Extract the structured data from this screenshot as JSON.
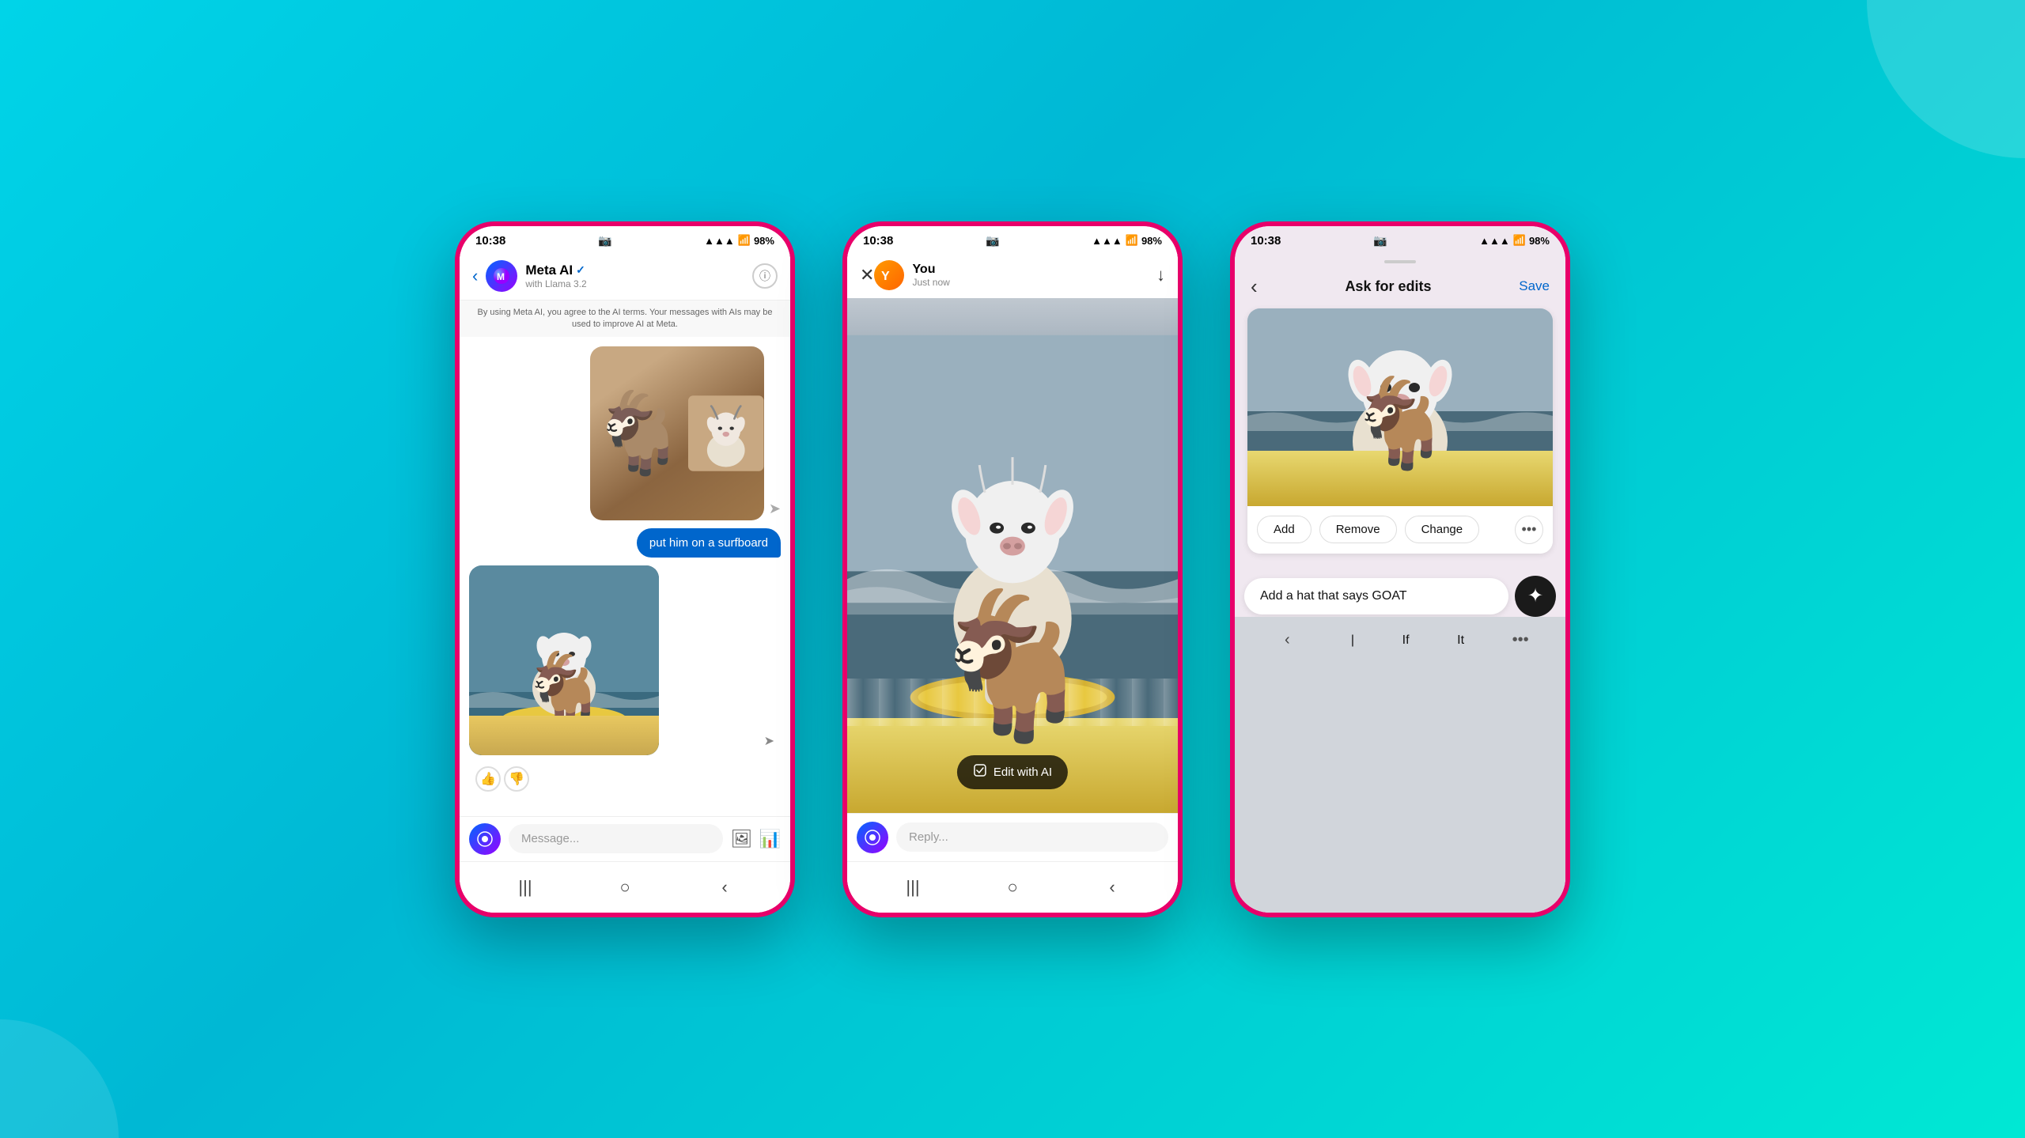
{
  "background": {
    "color": "#00d4e8"
  },
  "phone1": {
    "statusBar": {
      "time": "10:38",
      "battery": "98%"
    },
    "header": {
      "title": "Meta AI",
      "verified": true,
      "subtitle": "with Llama 3.2"
    },
    "disclaimer": "By using Meta AI, you agree to the AI terms. Your messages with AIs may be used to improve AI at Meta.",
    "message": {
      "bubble": "put him on a surfboard"
    },
    "reactions": {
      "thumbsUp": "👍",
      "thumbsDown": "👎"
    },
    "input": {
      "placeholder": "Message..."
    },
    "nav": {
      "menu": "☰",
      "home": "○",
      "back": "‹"
    }
  },
  "phone2": {
    "statusBar": {
      "time": "10:38",
      "battery": "98%"
    },
    "header": {
      "user": "You",
      "time": "Just now",
      "closeIcon": "✕",
      "downloadIcon": "↓"
    },
    "editButton": "Edit with AI",
    "input": {
      "placeholder": "Reply..."
    },
    "nav": {
      "menu": "☰",
      "home": "○",
      "back": "‹"
    }
  },
  "phone3": {
    "statusBar": {
      "time": "10:38",
      "battery": "98%"
    },
    "header": {
      "backIcon": "‹",
      "title": "Ask for edits",
      "saveLabel": "Save"
    },
    "editActions": {
      "add": "Add",
      "remove": "Remove",
      "change": "Change",
      "more": "•••"
    },
    "input": {
      "value": "Add a hat that says GOAT",
      "submitIcon": "✦"
    },
    "keyboard": {
      "back": "‹",
      "cursor": "|",
      "if": "If",
      "it": "It",
      "more": "•••"
    }
  }
}
